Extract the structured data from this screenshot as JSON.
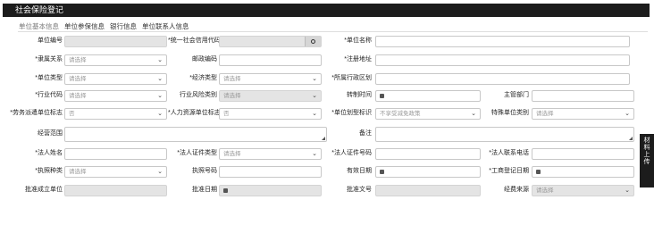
{
  "title": "社会保险登记",
  "tabs": [
    "单位基本信息",
    "单位参保信息",
    "银行信息",
    "单位联系人信息"
  ],
  "side_tab": "材料上传",
  "labels": {
    "unit_no": "单位编号",
    "credit_code": "统一社会信用代码",
    "unit_name": "单位名称",
    "affiliation": "隶属关系",
    "postal_code": "邮政编码",
    "reg_address": "注册地址",
    "unit_type": "单位类型",
    "econ_type": "经济类型",
    "region": "所属行政区划",
    "industry_code": "行业代码",
    "industry_risk": "行业风险类别",
    "transfer_time": "转制时间",
    "dept": "主管部门",
    "dispatch_flag": "劳务派遣单位标志",
    "hr_flag": "人力资源单位标志",
    "size_flag": "单位划型标识",
    "special_type": "特殊单位类别",
    "business_scope": "经营范围",
    "remark": "备注",
    "legal_name": "法人姓名",
    "legal_id_type": "法人证件类型",
    "legal_id_no": "法人证件号码",
    "legal_phone": "法人联系电话",
    "license_type": "执照种类",
    "license_no": "执照号码",
    "valid_date": "有效日期",
    "biz_reg_date": "工商登记日期",
    "approve_unit": "批准成立单位",
    "approve_date": "批准日期",
    "approve_doc": "批准文号",
    "fund_source": "经费来源"
  },
  "values": {
    "please_select": "请选择",
    "no": "否",
    "size_placeholder": "不享受减免政策"
  }
}
